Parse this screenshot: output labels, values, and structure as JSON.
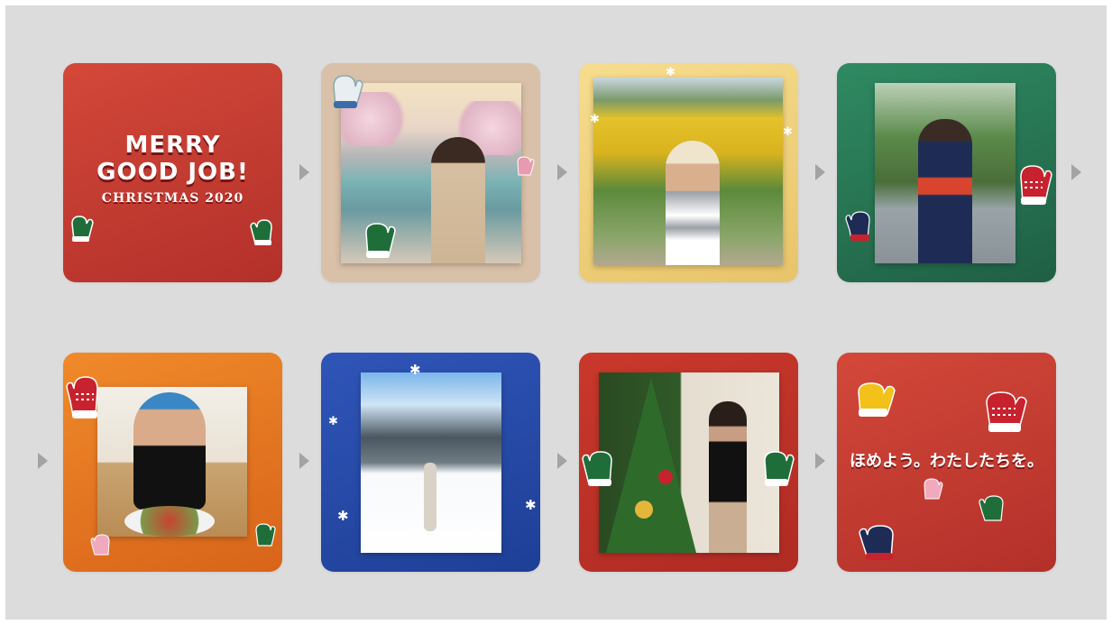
{
  "title_card": {
    "line1": "MERRY",
    "line2": "GOOD JOB!",
    "line3": "CHRISTMAS 2020"
  },
  "closing_card": {
    "message": "ほめよう。わたしたちを。"
  },
  "cards": [
    {
      "kind": "title",
      "bg": "#c0392e"
    },
    {
      "kind": "photo",
      "bg": "#d8bfa8",
      "scene": "woman by river with cherry blossoms"
    },
    {
      "kind": "photo",
      "bg": "#f0d27a",
      "scene": "woman in sunflower field"
    },
    {
      "kind": "photo",
      "bg": "#2a7a58",
      "scene": "woman in yukata on street"
    },
    {
      "kind": "photo",
      "bg": "#e8741c",
      "scene": "woman eating at table"
    },
    {
      "kind": "photo",
      "bg": "#2f4ea8",
      "scene": "woman doing yoga pose in snow"
    },
    {
      "kind": "photo",
      "bg": "#c0392e",
      "scene": "woman beside christmas tree"
    },
    {
      "kind": "message",
      "bg": "#c0392e"
    }
  ],
  "colors": {
    "background": "#dcdcdc",
    "arrow": "#a3a3a3",
    "mitten_green": "#1f6e3a",
    "mitten_red": "#c7222e",
    "mitten_yellow": "#f2c21a",
    "mitten_navy": "#1e2c55",
    "mitten_pink": "#e89bb0"
  }
}
